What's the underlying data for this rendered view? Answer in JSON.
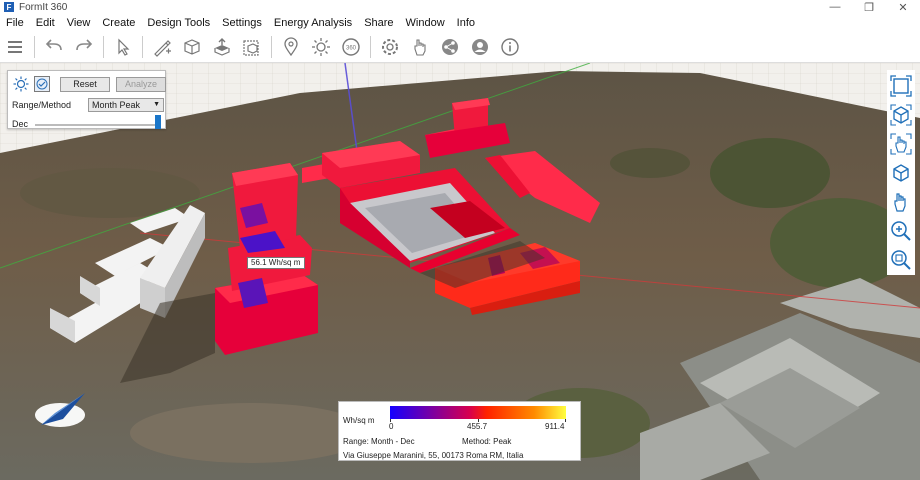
{
  "window": {
    "title": "FormIt 360",
    "logo_letter": "F"
  },
  "window_controls": {
    "minimize": "—",
    "restore": "❐",
    "close": "✕"
  },
  "menu": [
    "File",
    "Edit",
    "View",
    "Create",
    "Design Tools",
    "Settings",
    "Energy Analysis",
    "Share",
    "Window",
    "Info"
  ],
  "toolbar": {
    "icons": [
      "layers-icon",
      "undo-icon",
      "redo-icon",
      "select-icon",
      "sketch-icon",
      "box-icon",
      "extrude-icon",
      "group-icon",
      "location-icon",
      "sun-icon",
      "view-360-icon",
      "settings-icon",
      "pan-hand-icon",
      "share-icon",
      "profile-icon",
      "info-icon"
    ]
  },
  "analysis_panel": {
    "reset_label": "Reset",
    "analyze_label": "Analyze",
    "range_label": "Range/Method",
    "method_value": "Month Peak",
    "slider_label": "Dec",
    "slider_position": 1.0
  },
  "nav_tools": [
    "zoom-extents-icon",
    "view-cube-icon",
    "orbit-icon",
    "perspective-icon",
    "pan-icon",
    "zoom-in-icon",
    "zoom-region-icon"
  ],
  "tooltip": {
    "text": "56.1 Wh/sq m"
  },
  "legend": {
    "unit": "Wh/sq m",
    "min": "0",
    "mid": "455.7",
    "max": "911.4",
    "range_text": "Range: Month - Dec",
    "method_text": "Method: Peak",
    "address": "Via Giuseppe Maranini, 55, 00173 Roma RM, Italia",
    "colors": {
      "low": "#1400ff",
      "mid": "#ff2200",
      "high": "#ffff40"
    }
  },
  "colors": {
    "building_hot": "#ff1a3c",
    "building_top": "#ff2b4a",
    "building_shade": "#7a10a0",
    "building_neutral": "#e3e3e3",
    "ground": "#6a5a44"
  }
}
